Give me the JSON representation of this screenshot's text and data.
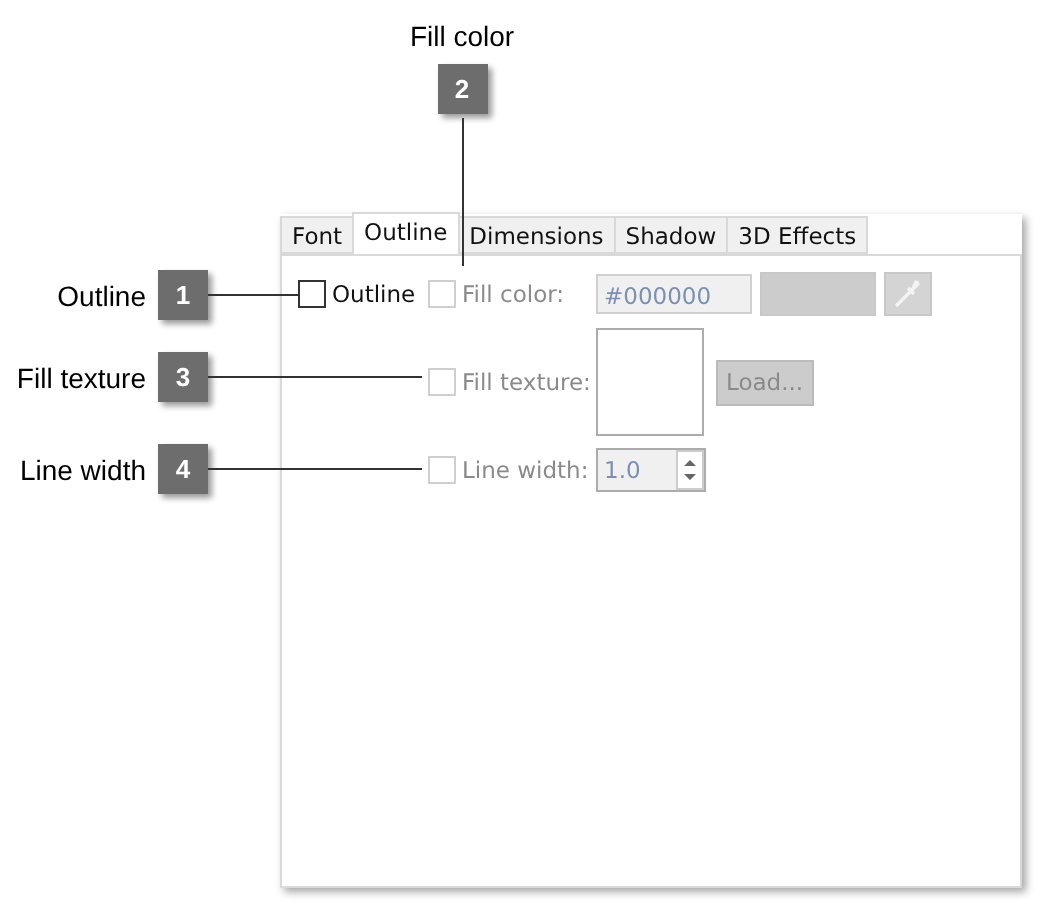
{
  "callouts": [
    {
      "number": "1",
      "label": "Outline",
      "kind": "side"
    },
    {
      "number": "2",
      "label": "Fill color",
      "kind": "top"
    },
    {
      "number": "3",
      "label": "Fill texture",
      "kind": "side"
    },
    {
      "number": "4",
      "label": "Line width",
      "kind": "side"
    }
  ],
  "tabs": [
    {
      "label": "Font",
      "selected": false
    },
    {
      "label": "Outline",
      "selected": true
    },
    {
      "label": "Dimensions",
      "selected": false
    },
    {
      "label": "Shadow",
      "selected": false
    },
    {
      "label": "3D Effects",
      "selected": false
    }
  ],
  "outline": {
    "label": "Outline",
    "checked": false
  },
  "fill_color": {
    "label": "Fill color:",
    "checked": false,
    "disabled": true,
    "value": "#000000"
  },
  "fill_texture": {
    "label": "Fill texture:",
    "checked": false,
    "disabled": true,
    "button": "Load..."
  },
  "line_width": {
    "label": "Line width:",
    "checked": false,
    "disabled": true,
    "value": "1.0"
  }
}
